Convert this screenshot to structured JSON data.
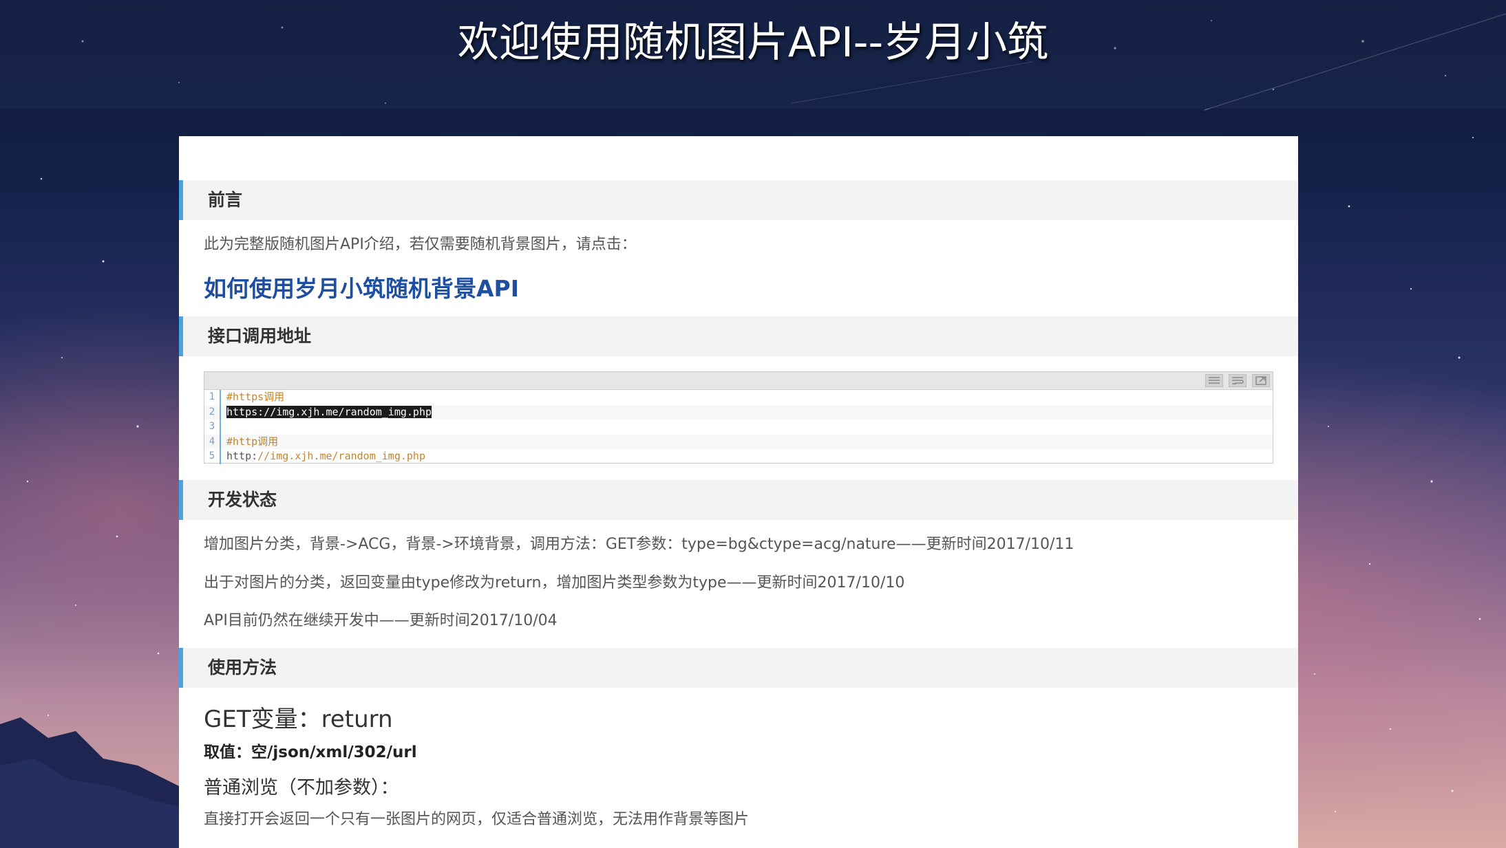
{
  "site": {
    "title": "欢迎使用随机图片API--岁月小筑"
  },
  "sections": {
    "preface": {
      "heading": "前言",
      "text": "此为完整版随机图片API介绍，若仅需要随机背景图片，请点击：",
      "link": "如何使用岁月小筑随机背景API"
    },
    "endpoint": {
      "heading": "接口调用地址",
      "code_lines": [
        {
          "num": "1",
          "comment": "#https调用",
          "plain": "",
          "url": ""
        },
        {
          "num": "2",
          "comment": "",
          "plain": "https://img.xjh.me/random_img.php",
          "url": ""
        },
        {
          "num": "3",
          "comment": "",
          "plain": "",
          "url": ""
        },
        {
          "num": "4",
          "comment": "#http调用",
          "plain": "",
          "url": ""
        },
        {
          "num": "5",
          "comment": "",
          "plain": "http:",
          "url": "//img.xjh.me/random_img.php"
        }
      ]
    },
    "status": {
      "heading": "开发状态",
      "updates": [
        "增加图片分类，背景->ACG，背景->环境背景，调用方法：GET参数：type=bg&ctype=acg/nature——更新时间2017/10/11",
        "出于对图片的分类，返回变量由type修改为return，增加图片类型参数为type——更新时间2017/10/10",
        "API目前仍然在继续开发中——更新时间2017/10/04"
      ]
    },
    "usage": {
      "heading": "使用方法",
      "get_var": "GET变量：return",
      "values": "取值：空/json/xml/302/url",
      "browse_title": "普通浏览（不加参数）：",
      "browse_desc": "直接打开会返回一个只有一张图片的网页，仅适合普通浏览，无法用作背景等图片"
    }
  },
  "colors": {
    "accent_bar": "#4aa3df",
    "link": "#1e4fa0",
    "comment": "#c0862e"
  },
  "icons": {
    "toolbar": [
      "view-source-icon",
      "wrap-lines-icon",
      "open-new-window-icon"
    ]
  }
}
